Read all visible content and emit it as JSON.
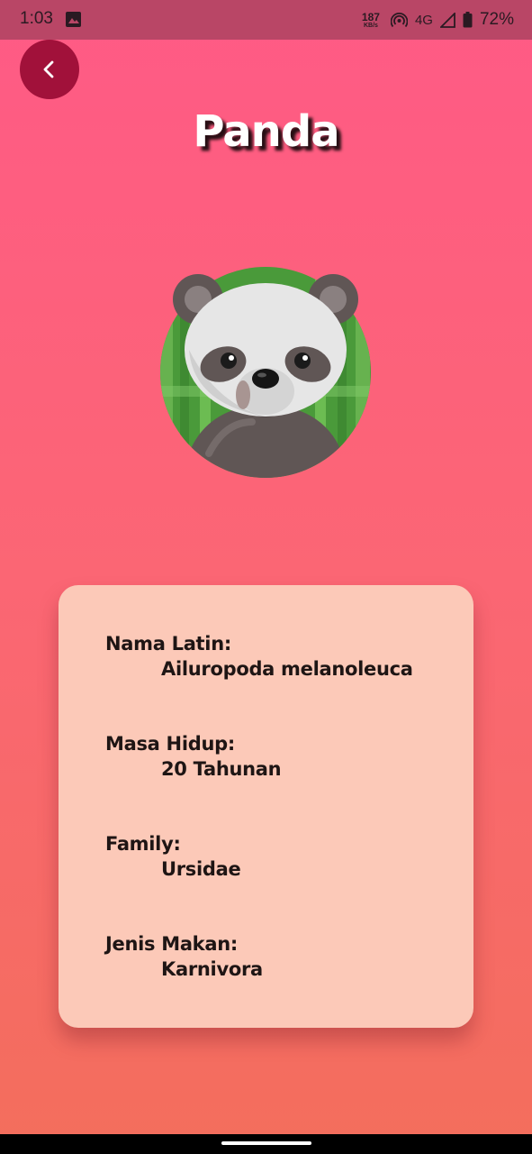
{
  "status_bar": {
    "time": "1:03",
    "netspeed_value": "187",
    "netspeed_unit": "KB/s",
    "network_type": "4G",
    "battery": "72%"
  },
  "header": {
    "title": "Panda"
  },
  "info": {
    "nama_latin_label": "Nama Latin:",
    "nama_latin_value": "Ailuropoda melanoleuca",
    "masa_hidup_label": "Masa Hidup:",
    "masa_hidup_value": "20 Tahunan",
    "family_label": "Family:",
    "family_value": "Ursidae",
    "jenis_makan_label": "Jenis Makan:",
    "jenis_makan_value": "Karnivora"
  },
  "icons": {
    "back": "chevron-left-icon",
    "avatar": "panda-icon"
  },
  "colors": {
    "gradient_top": "#ff5a86",
    "gradient_bottom": "#f36e5c",
    "back_button": "#a1113a",
    "card": "#fcc9b8",
    "status_bar": "#b94666"
  }
}
